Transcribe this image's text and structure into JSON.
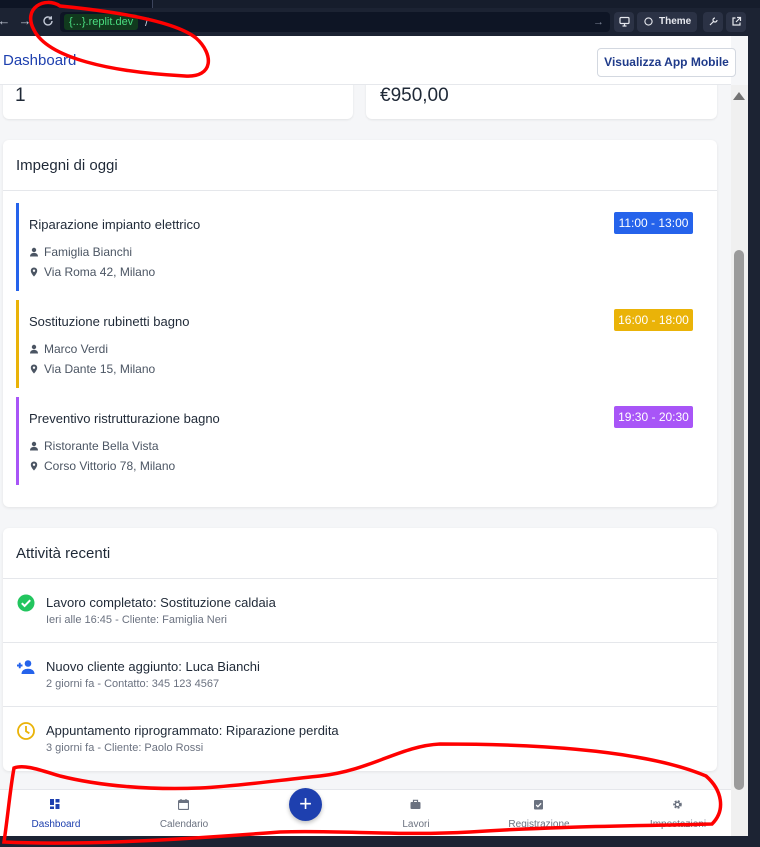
{
  "browser": {
    "url_host": "{...}.replit.dev",
    "url_path": "/",
    "theme_label": "Theme"
  },
  "header": {
    "title": "Dashboard",
    "mobile_button": "Visualizza App Mobile"
  },
  "stats": [
    {
      "value": "1"
    },
    {
      "value": "€950,00"
    }
  ],
  "today": {
    "title": "Impegni di oggi",
    "items": [
      {
        "title": "Riparazione impianto elettrico",
        "client": "Famiglia Bianchi",
        "address": "Via Roma 42, Milano",
        "time": "11:00 - 13:00",
        "color": "#2563eb"
      },
      {
        "title": "Sostituzione rubinetti bagno",
        "client": "Marco Verdi",
        "address": "Via Dante 15, Milano",
        "time": "16:00 - 18:00",
        "color": "#eab308"
      },
      {
        "title": "Preventivo ristrutturazione bagno",
        "client": "Ristorante Bella Vista",
        "address": "Corso Vittorio 78, Milano",
        "time": "19:30 - 20:30",
        "color": "#a855f7"
      }
    ]
  },
  "recent": {
    "title": "Attività recenti",
    "items": [
      {
        "icon": "check-circle-icon",
        "title": "Lavoro completato: Sostituzione caldaia",
        "subtitle": "Ieri alle 16:45 - Cliente: Famiglia Neri",
        "color": "#22c55e"
      },
      {
        "icon": "person-add-icon",
        "title": "Nuovo cliente aggiunto: Luca Bianchi",
        "subtitle": "2 giorni fa - Contatto: 345 123 4567",
        "color": "#2563eb"
      },
      {
        "icon": "clock-icon",
        "title": "Appuntamento riprogrammato: Riparazione perdita",
        "subtitle": "3 giorni fa - Cliente: Paolo Rossi",
        "color": "#eab308"
      }
    ]
  },
  "bottom_nav": {
    "items": [
      {
        "label": "Dashboard",
        "icon": "dashboard-icon",
        "active": true
      },
      {
        "label": "Calendario",
        "icon": "calendar-icon",
        "active": false
      },
      {
        "label": "Lavori",
        "icon": "briefcase-icon",
        "active": false
      },
      {
        "label": "Registrazione",
        "icon": "clipboard-check-icon",
        "active": false
      },
      {
        "label": "Impostazioni",
        "icon": "gear-icon",
        "active": false
      }
    ],
    "add_label": "+"
  },
  "colors": {
    "primary": "#1e40af",
    "annotation": "#ff0000"
  }
}
